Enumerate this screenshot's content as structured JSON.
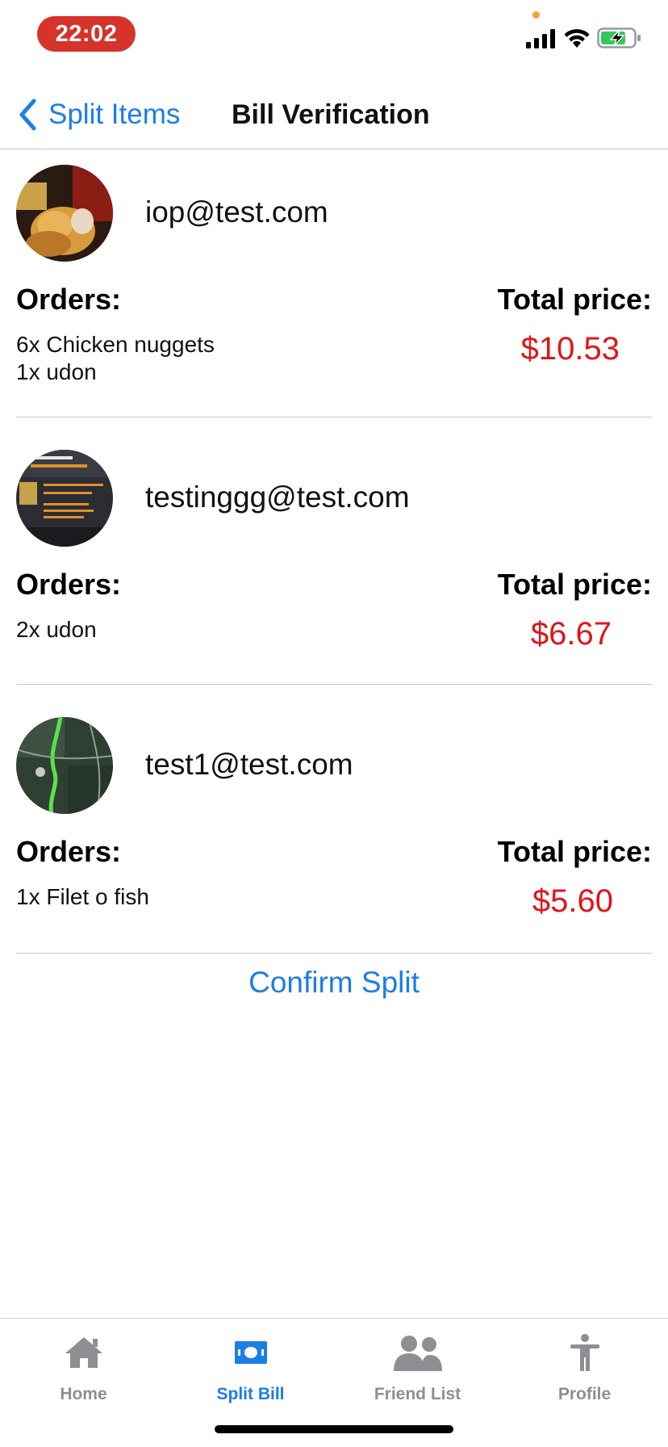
{
  "status_bar": {
    "time": "22:02"
  },
  "nav": {
    "back_label": "Split Items",
    "title": "Bill Verification"
  },
  "headings": {
    "orders": "Orders:",
    "total_price": "Total price:"
  },
  "users": [
    {
      "email": "iop@test.com",
      "orders": [
        "6x Chicken nuggets",
        "1x udon"
      ],
      "total": "$10.53",
      "avatar": "food-photo-avatar"
    },
    {
      "email": "testinggg@test.com",
      "orders": [
        "2x udon"
      ],
      "total": "$6.67",
      "avatar": "coupon-screenshot-avatar"
    },
    {
      "email": "test1@test.com",
      "orders": [
        "1x Filet o fish"
      ],
      "total": "$5.60",
      "avatar": "map-avatar"
    }
  ],
  "confirm_label": "Confirm Split",
  "tabs": [
    {
      "label": "Home",
      "icon": "home-icon",
      "active": false
    },
    {
      "label": "Split Bill",
      "icon": "money-icon",
      "active": true
    },
    {
      "label": "Friend List",
      "icon": "people-icon",
      "active": false
    },
    {
      "label": "Profile",
      "icon": "person-icon",
      "active": false
    }
  ],
  "colors": {
    "accent": "#1a7ee6",
    "price": "#e0151b",
    "time_pill": "#d6332b",
    "tab_inactive": "#8e8e93"
  }
}
